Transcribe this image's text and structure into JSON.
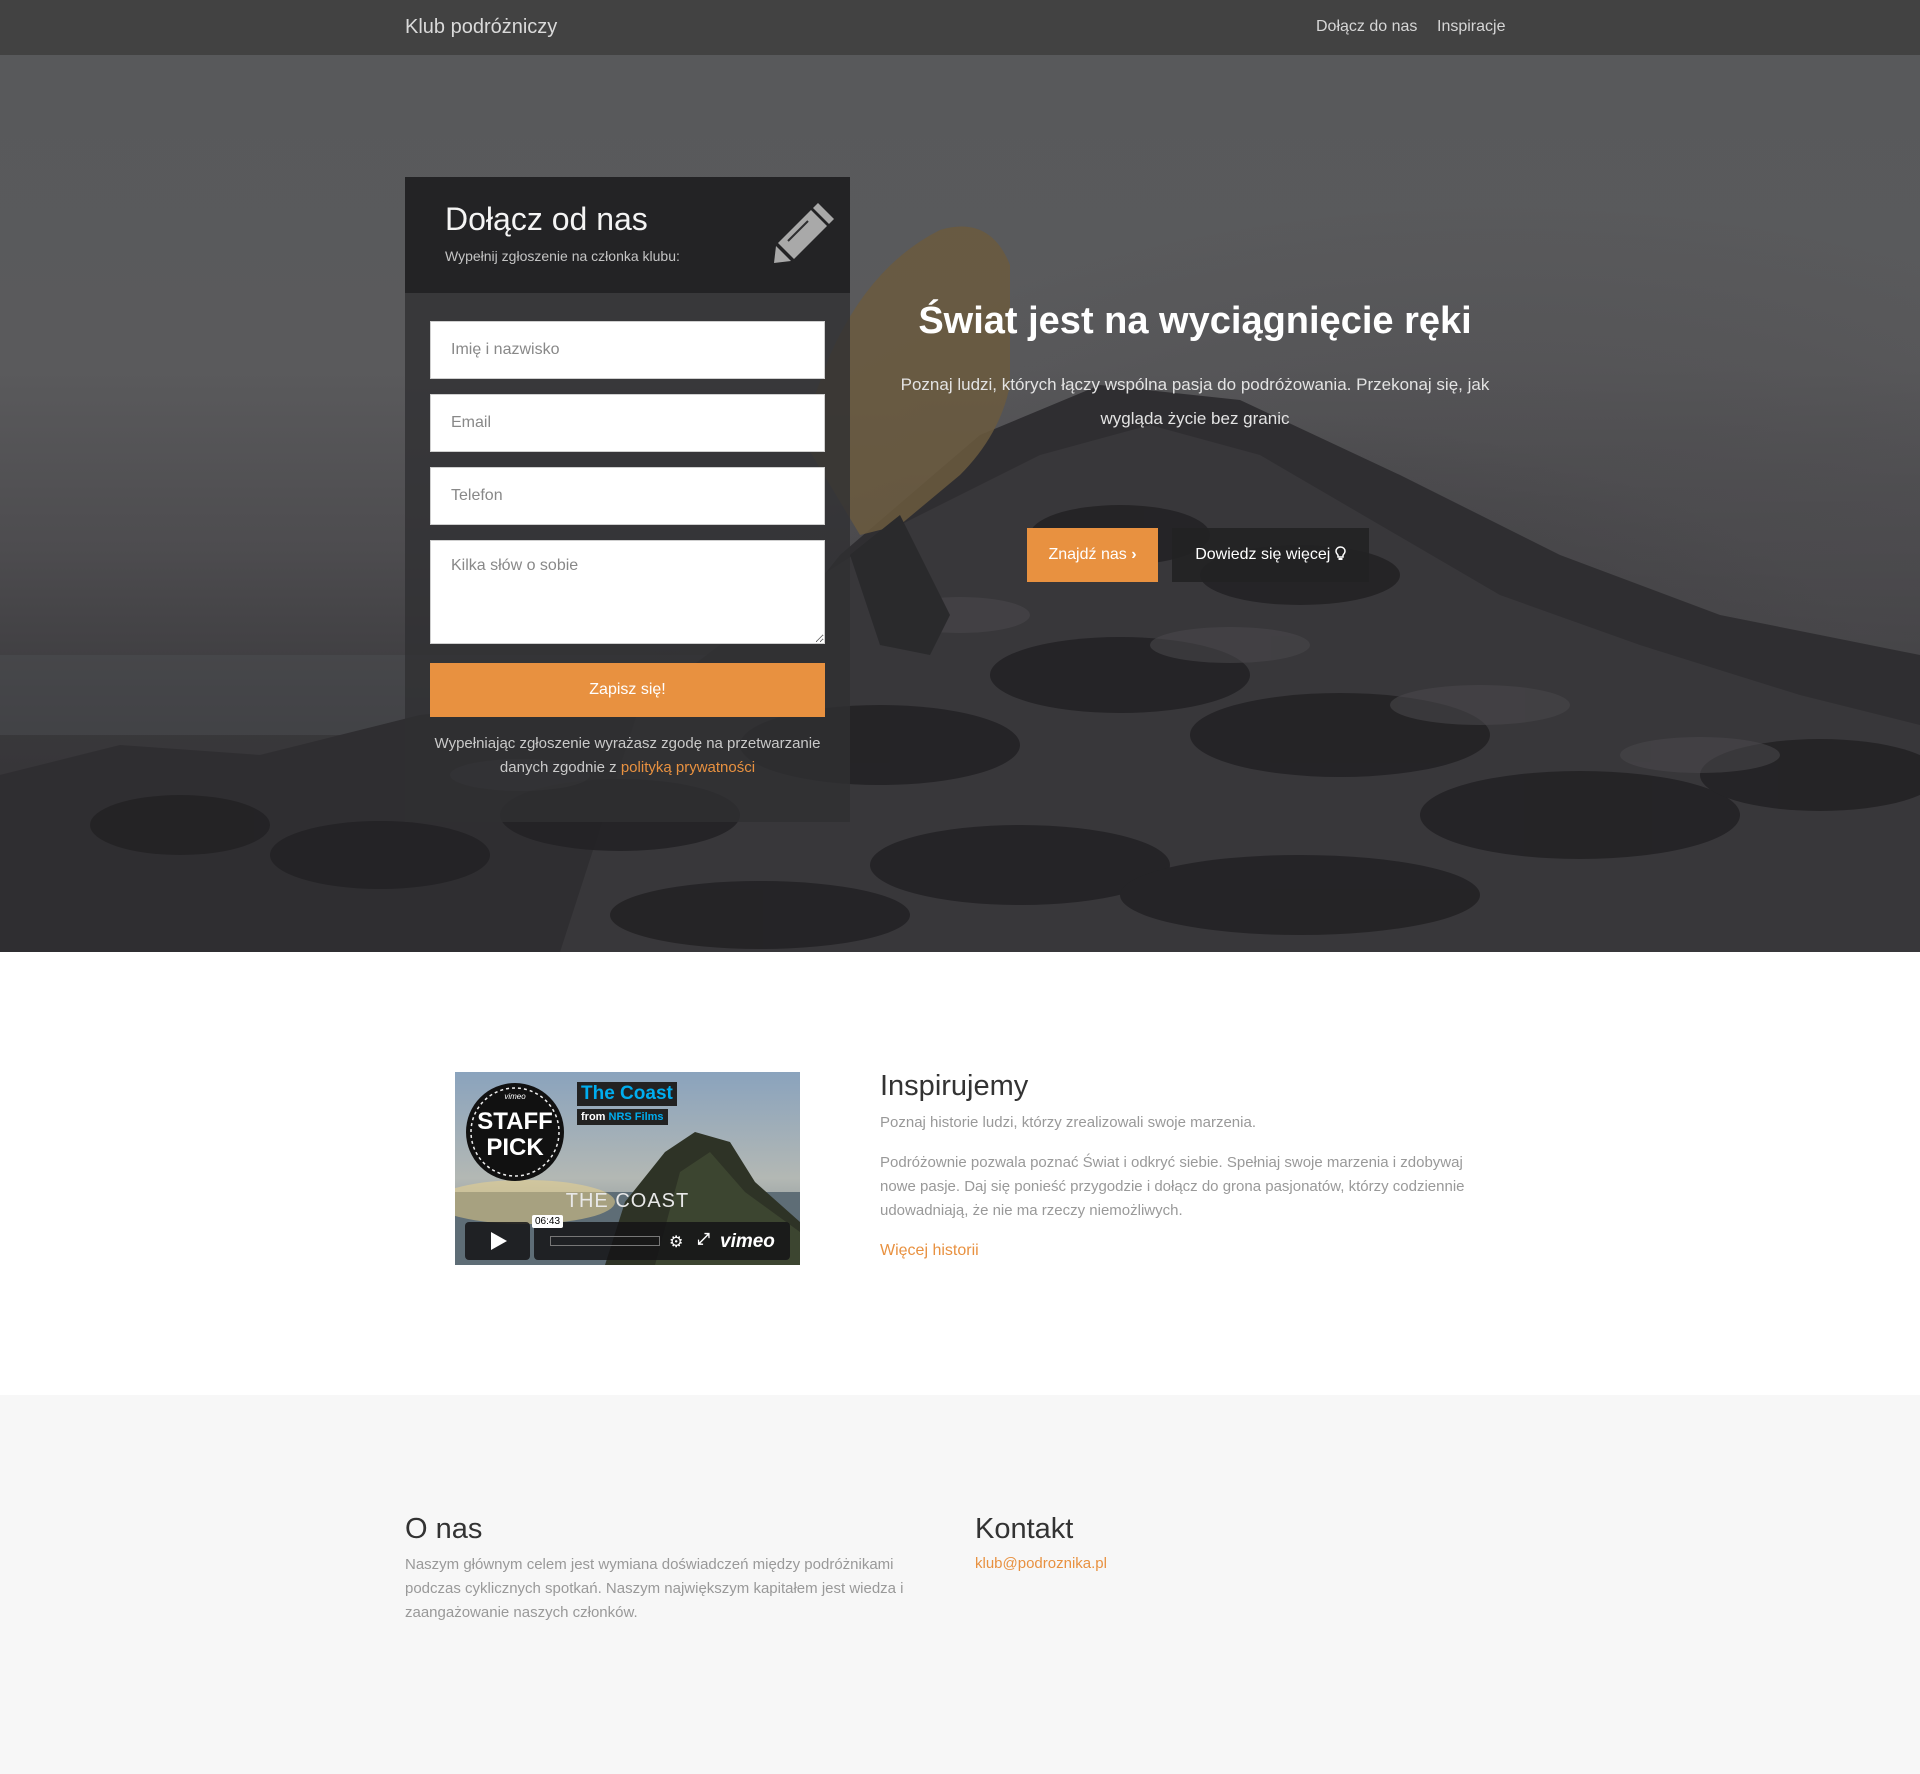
{
  "navbar": {
    "brand": "Klub podróżniczy",
    "links": [
      "Dołącz do nas",
      "Inspiracje"
    ]
  },
  "form": {
    "title": "Dołącz od nas",
    "subtitle": "Wypełnij zgłoszenie na członka klubu:",
    "icon": "pencil-icon",
    "placeholders": {
      "name": "Imię i nazwisko",
      "email": "Email",
      "phone": "Telefon",
      "about": "Kilka słów o sobie"
    },
    "submit_label": "Zapisz się!",
    "consent_text": "Wypełniając zgłoszenie wyrażasz zgodę na przetwarzanie danych zgodnie z",
    "consent_link": "polityką prywatności"
  },
  "hero": {
    "title": "Świat jest na wyciągnięcie ręki",
    "lead": "Poznaj ludzi, których łączy wspólna pasja do podróżowania. Przekonaj się, jak wygląda życie bez granic",
    "btn_find": "Znajdź nas",
    "btn_find_icon": "chevron-right-icon",
    "btn_more": "Dowiedz się więcej",
    "btn_more_icon": "lightbulb-icon"
  },
  "video": {
    "title": "The Coast",
    "from_label": "from",
    "author": "NRS Films",
    "badge_top": "vimeo",
    "badge_line1": "STAFF",
    "badge_line2": "PICK",
    "overlay_title": "THE COAST",
    "duration": "06:43",
    "logo": "vimeo"
  },
  "inspire": {
    "title": "Inspirujemy",
    "lead": "Poznaj historie ludzi, którzy zrealizowali swoje marzenia.",
    "body": "Podróżownie pozwala poznać Świat i odkryć siebie. Spełniaj swoje marzenia i zdobywaj nowe pasje. Daj się ponieść przygodzie i dołącz do grona pasjonatów, którzy codziennie udowadniają, że nie ma rzeczy niemożliwych.",
    "link": "Więcej historii"
  },
  "about": {
    "title": "O nas",
    "text": "Naszym głównym celem jest wymiana doświadczeń między podróżnikami podczas cyklicznych spotkań. Naszym największym kapitałem jest wiedza i zaangażowanie naszych członków."
  },
  "contact": {
    "title": "Kontakt",
    "email": "klub@podroznika.pl"
  },
  "colors": {
    "accent": "#e89140",
    "navbar": "#424242",
    "footer_bg": "#f7f7f7"
  }
}
